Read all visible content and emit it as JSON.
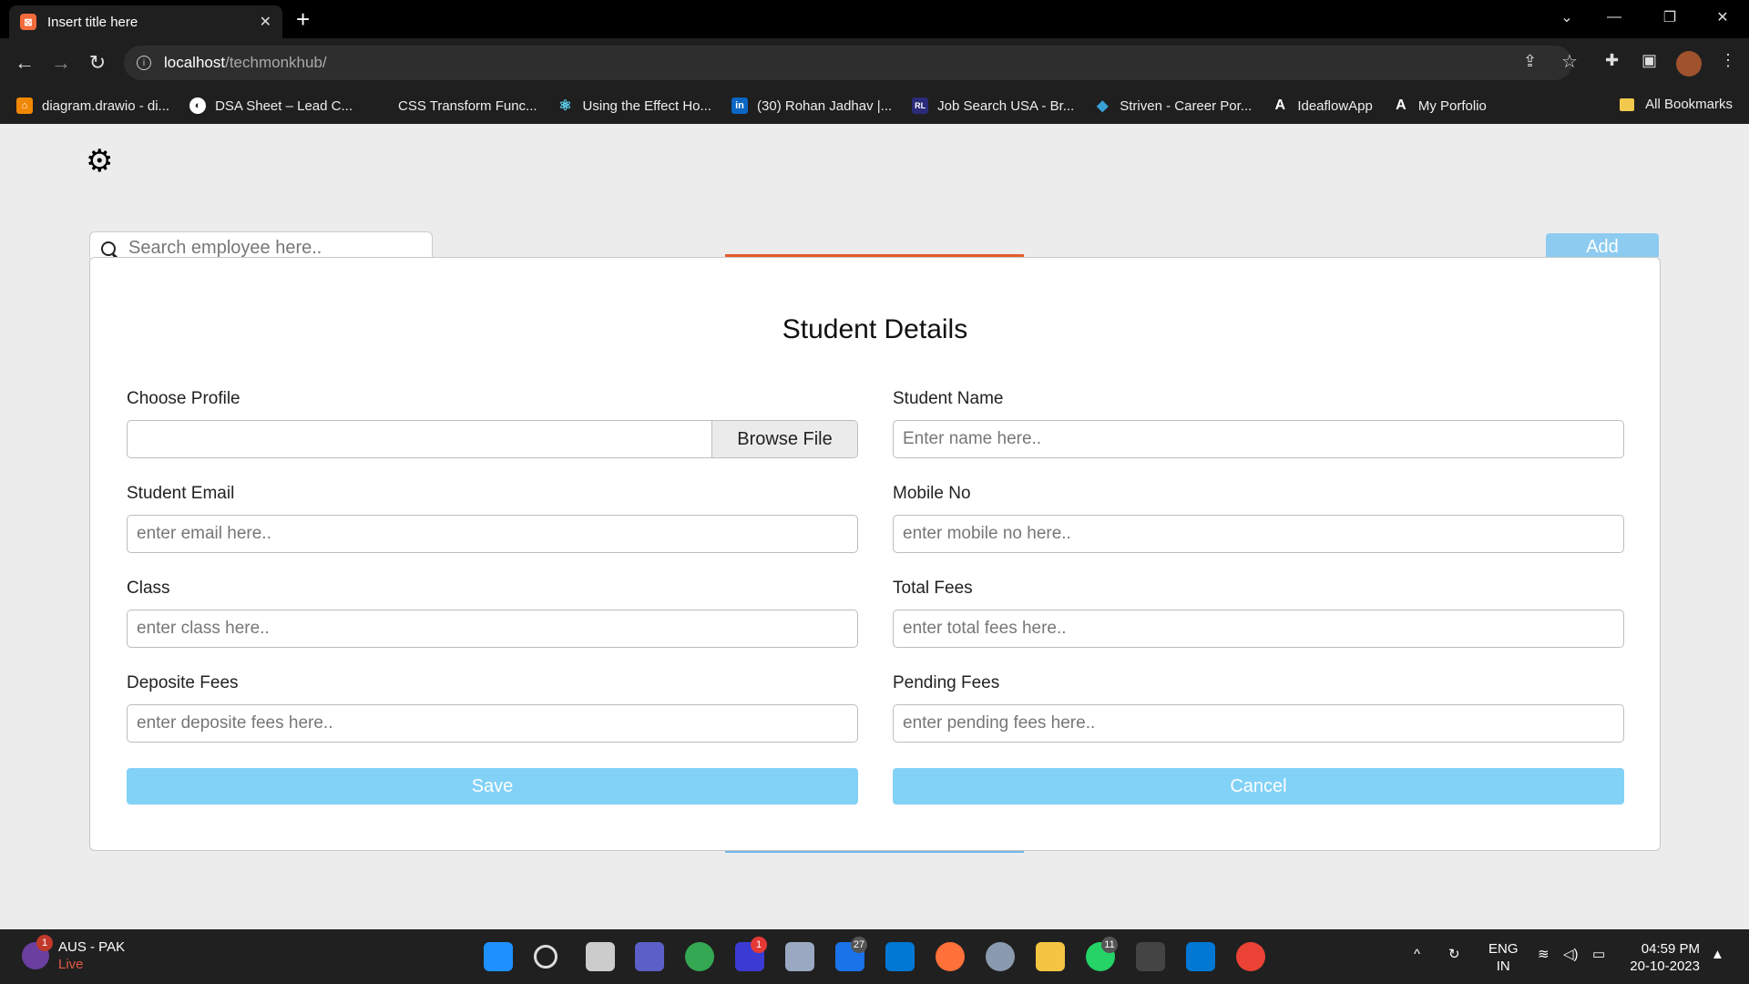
{
  "browser": {
    "tab_title": "Insert title here",
    "url_host": "localhost",
    "url_path": "/techmonkhub/",
    "bookmarks": [
      {
        "label": "diagram.drawio - di...",
        "color": "#f08705",
        "icon": "drawio-icon"
      },
      {
        "label": "DSA Sheet – Lead C...",
        "color": "#ffffff",
        "icon": "globe-icon"
      },
      {
        "label": "CSS Transform Func...",
        "color": "#1f1f1f",
        "icon": "blank-icon"
      },
      {
        "label": "Using the Effect Ho...",
        "color": "#61dafb",
        "icon": "react-icon"
      },
      {
        "label": "(30) Rohan Jadhav |...",
        "color": "#0a66c2",
        "icon": "linkedin-icon"
      },
      {
        "label": "Job Search USA - Br...",
        "color": "#2b2b7a",
        "icon": "rl-icon"
      },
      {
        "label": "Striven - Career Por...",
        "color": "#3aa0d8",
        "icon": "striven-icon"
      },
      {
        "label": "IdeaflowApp",
        "color": "#ffffff",
        "icon": "ideaflow-icon"
      },
      {
        "label": "My Porfolio",
        "color": "#ffffff",
        "icon": "portfolio-icon"
      }
    ],
    "all_bookmarks": "All Bookmarks"
  },
  "page": {
    "search_placeholder": "Search employee here..",
    "add_label": "Add"
  },
  "modal": {
    "title": "Student Details",
    "choose_profile_label": "Choose Profile",
    "browse_label": "Browse File",
    "student_name_label": "Student Name",
    "student_name_placeholder": "Enter name here..",
    "email_label": "Student Email",
    "email_placeholder": "enter email here..",
    "mobile_label": "Mobile No",
    "mobile_placeholder": "enter mobile no here..",
    "class_label": "Class",
    "class_placeholder": "enter class here..",
    "total_fees_label": "Total Fees",
    "total_fees_placeholder": "enter total fees here..",
    "deposite_label": "Deposite Fees",
    "deposite_placeholder": "enter deposite fees here..",
    "pending_label": "Pending Fees",
    "pending_placeholder": "enter pending fees here..",
    "save_label": "Save",
    "cancel_label": "Cancel"
  },
  "taskbar": {
    "weather_title": "AUS - PAK",
    "weather_sub": "Live",
    "weather_badge": "1",
    "teams_badge": "1",
    "mail_badge": "27",
    "whatsapp_badge": "11",
    "lang_top": "ENG",
    "lang_bottom": "IN",
    "time": "04:59 PM",
    "date": "20-10-2023"
  }
}
